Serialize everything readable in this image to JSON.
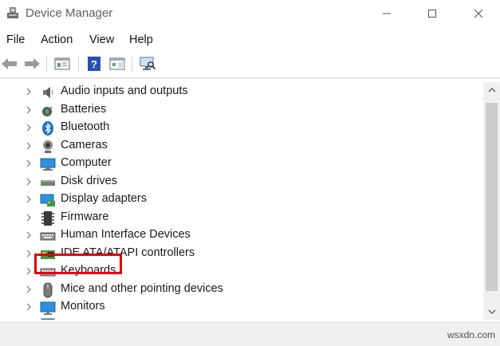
{
  "window": {
    "title": "Device Manager",
    "icons": {
      "app": "device-manager-icon",
      "minimize": "minimize-icon",
      "maximize": "maximize-icon",
      "close": "close-icon"
    }
  },
  "menu": [
    "File",
    "Action",
    "View",
    "Help"
  ],
  "toolbar": {
    "buttons": [
      "back-arrow-icon",
      "forward-arrow-icon",
      "properties-icon",
      "help-icon",
      "details-pane-icon",
      "scan-hardware-icon"
    ]
  },
  "tree": {
    "items": [
      {
        "label": "Audio inputs and outputs",
        "icon": "speaker-icon"
      },
      {
        "label": "Batteries",
        "icon": "battery-icon"
      },
      {
        "label": "Bluetooth",
        "icon": "bluetooth-icon"
      },
      {
        "label": "Cameras",
        "icon": "camera-icon"
      },
      {
        "label": "Computer",
        "icon": "computer-icon"
      },
      {
        "label": "Disk drives",
        "icon": "disk-drive-icon",
        "highlighted": true
      },
      {
        "label": "Display adapters",
        "icon": "display-adapter-icon"
      },
      {
        "label": "Firmware",
        "icon": "firmware-icon"
      },
      {
        "label": "Human Interface Devices",
        "icon": "hid-icon"
      },
      {
        "label": "IDE ATA/ATAPI controllers",
        "icon": "ide-controller-icon"
      },
      {
        "label": "Keyboards",
        "icon": "keyboard-icon"
      },
      {
        "label": "Mice and other pointing devices",
        "icon": "mouse-icon"
      },
      {
        "label": "Monitors",
        "icon": "monitor-icon"
      },
      {
        "label": "",
        "icon": "network-adapter-icon"
      }
    ]
  },
  "status": {
    "watermark": "wsxdn.com"
  },
  "colors": {
    "highlight": "#e3000f",
    "accent": "#1e73c8"
  }
}
